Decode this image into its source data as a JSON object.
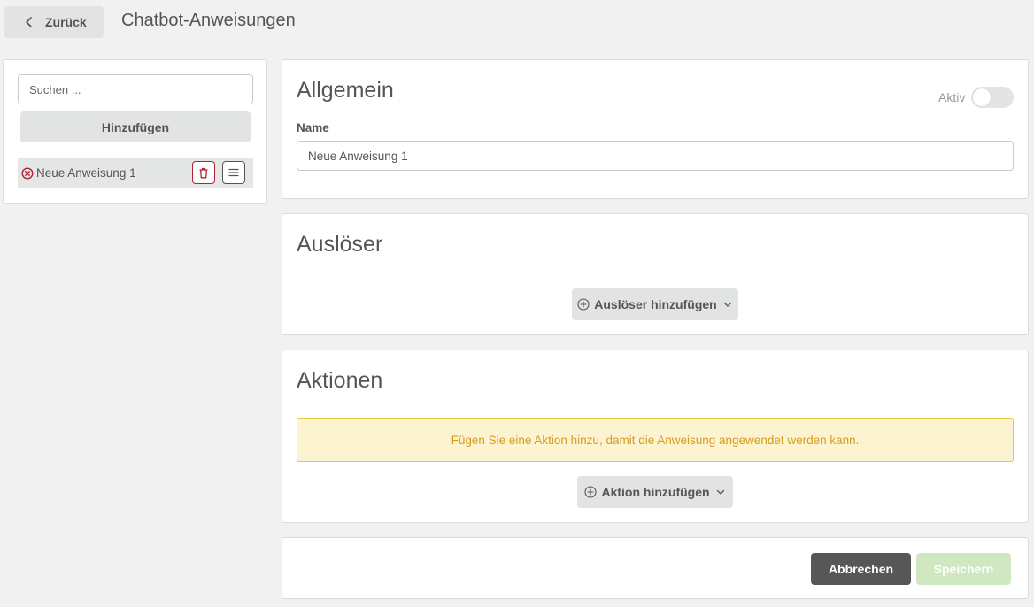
{
  "header": {
    "back_label": "Zurück",
    "title": "Chatbot-Anweisungen"
  },
  "sidebar": {
    "search_placeholder": "Suchen ...",
    "add_label": "Hinzufügen",
    "items": [
      {
        "label": "Neue Anweisung 1",
        "status": "error"
      }
    ]
  },
  "general": {
    "title": "Allgemein",
    "active_label": "Aktiv",
    "active": false,
    "name_label": "Name",
    "name_value": "Neue Anweisung 1"
  },
  "triggers": {
    "title": "Auslöser",
    "add_label": "Auslöser hinzufügen"
  },
  "actions": {
    "title": "Aktionen",
    "warning": "Fügen Sie eine Aktion hinzu, damit die Anweisung angewendet werden kann.",
    "add_label": "Aktion hinzufügen"
  },
  "footer": {
    "cancel_label": "Abbrechen",
    "save_label": "Speichern"
  },
  "colors": {
    "background": "#f0f1f0",
    "danger": "#b22234",
    "warning_bg": "#fcf3d0",
    "warning_border": "#e8c742",
    "warning_text": "#d69d1d",
    "cancel_bg": "#575757",
    "save_bg_disabled": "#cfe8c1"
  },
  "icons": {
    "back": "chevron-left-icon",
    "item_status": "circle-x-icon",
    "delete": "trash-icon",
    "menu": "hamburger-icon",
    "add": "plus-circle-icon",
    "dropdown": "chevron-down-icon"
  }
}
